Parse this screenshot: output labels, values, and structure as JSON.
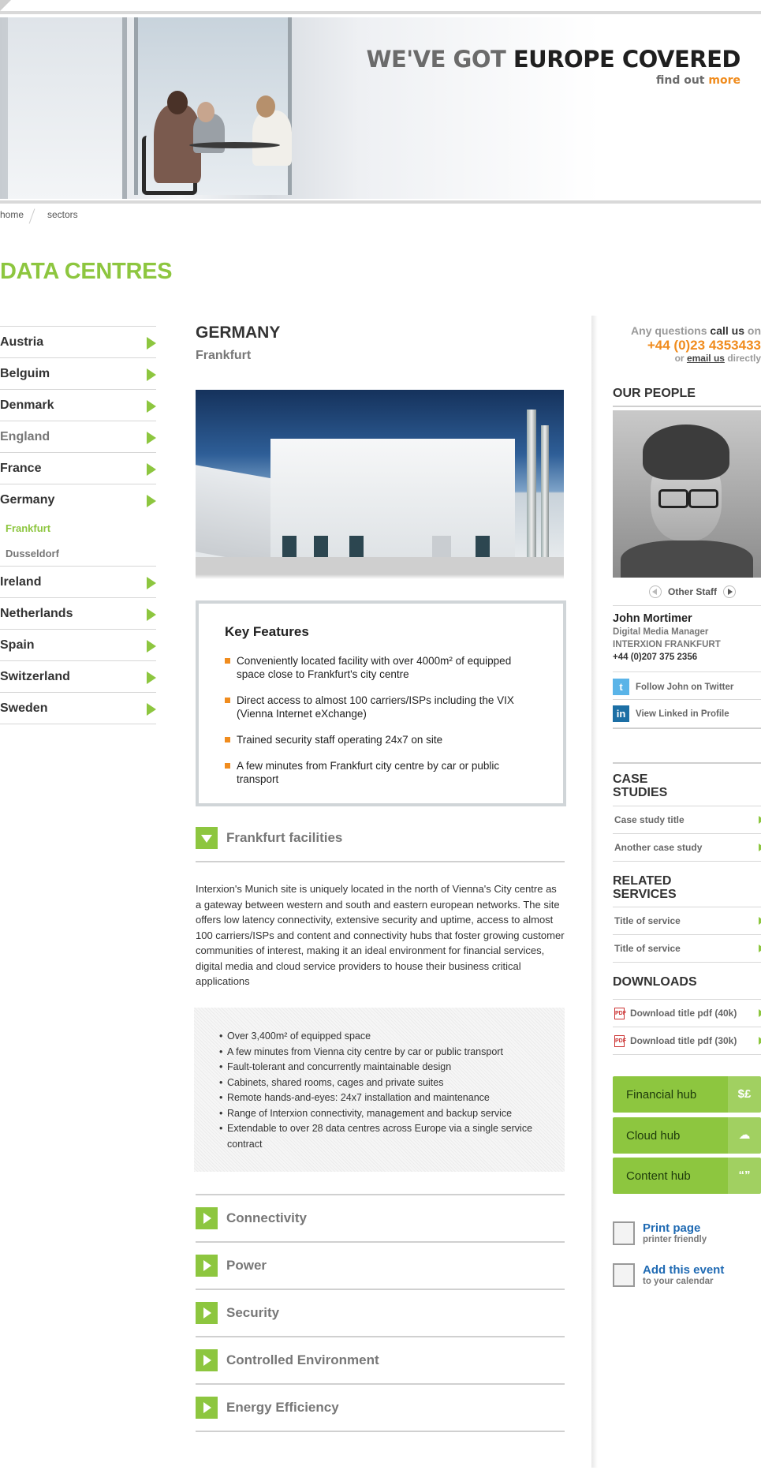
{
  "header": {
    "title_light": "WE'VE GOT",
    "title_dark": "EUROPE COVERED",
    "sub_prefix": "find out",
    "sub_link": "more"
  },
  "breadcrumb": [
    "home",
    "sectors"
  ],
  "page_title": "DATA CENTRES",
  "nav": {
    "countries_top": [
      "Austria",
      "Belguim",
      "Denmark",
      "England",
      "France",
      "Germany"
    ],
    "sub_items": [
      "Frankfurt",
      "Dusseldorf"
    ],
    "countries_bottom": [
      "Ireland",
      "Netherlands",
      "Spain",
      "Switzerland",
      "Sweden"
    ]
  },
  "main": {
    "country": "GERMANY",
    "city": "Frankfurt",
    "key_features_title": "Key Features",
    "key_features": [
      "Conveniently located facility with over 4000m² of equipped space close to Frankfurt's city centre",
      "Direct access to almost 100 carriers/ISPs including the VIX (Vienna Internet eXchange)",
      "Trained security staff operating 24x7 on site",
      "A few minutes from Frankfurt city centre by car or public transport"
    ],
    "facilities_label": "Frankfurt facilities",
    "paragraph": "Interxion's Munich site is uniquely located in the north of Vienna's City centre as a gateway between western and south and eastern european networks. The site offers low latency connectivity, extensive security and uptime, access to almost 100 carriers/ISPs and content and connectivity hubs that foster growing customer communities of interest, making it an ideal environment for financial services, digital media and cloud service providers to house their business critical applications",
    "bullets": [
      "Over 3,400m² of equipped space",
      "A few minutes from Vienna city centre by car or public transport",
      "Fault-tolerant and concurrently maintainable design",
      "Cabinets, shared rooms, cages and private suites",
      "Remote hands-and-eyes: 24x7 installation and maintenance",
      "Range of Interxion connectivity, management and backup service",
      "Extendable to over 28 data centres across Europe via a single service contract"
    ],
    "sections": [
      "Connectivity",
      "Power",
      "Security",
      "Controlled Environment",
      "Energy Efficiency"
    ]
  },
  "sidebar": {
    "questions_prefix": "Any questions",
    "questions_bold": "call us",
    "questions_suffix": "on",
    "phone": "+44 (0)23 4353433",
    "email_prefix": "or",
    "email_link": "email us",
    "email_suffix": "directly",
    "our_people": "OUR PEOPLE",
    "other_staff": "Other Staff",
    "person_name": "John Mortimer",
    "person_role": "Digital Media Manager",
    "person_company": "INTERXION FRANKFURT",
    "person_phone": "+44 (0)207 375 2356",
    "twitter": "Follow John on Twitter",
    "linkedin": "View Linked in Profile",
    "case_studies_title_1": "CASE",
    "case_studies_title_2": "STUDIES",
    "case_studies": [
      "Case study title",
      "Another case study"
    ],
    "related_title_1": "RELATED",
    "related_title_2": "SERVICES",
    "related": [
      "Title of service",
      "Title of service"
    ],
    "downloads_title": "DOWNLOADS",
    "downloads": [
      "Download title pdf (40k)",
      "Download title pdf (30k)"
    ],
    "hubs": [
      {
        "label": "Financial hub",
        "icon": "$£"
      },
      {
        "label": "Cloud hub",
        "icon": "☁"
      },
      {
        "label": "Content hub",
        "icon": "“”"
      }
    ],
    "print_title": "Print page",
    "print_sub": "printer friendly",
    "event_title": "Add this event",
    "event_sub": "to your calendar"
  },
  "colors": {
    "accent_green": "#8dc63f",
    "accent_orange": "#f08c1e",
    "link_blue": "#1f6ab3"
  }
}
